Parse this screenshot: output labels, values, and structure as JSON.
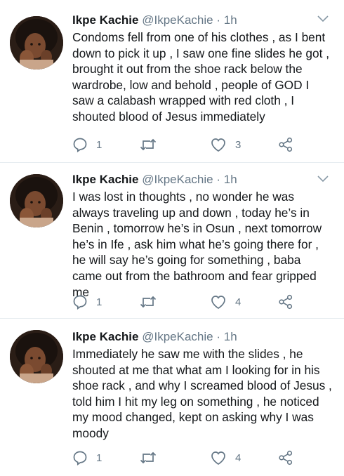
{
  "tweets": [
    {
      "name": "Ikpe Kachie",
      "handle": "@IkpeKachie",
      "separator": "·",
      "time": "1h",
      "text": "Condoms fell from one of his clothes , as I bent down to pick it up , I saw one fine slides he got , brought it out from the shoe rack below the wardrobe, low and behold , people of GOD I saw a calabash wrapped with red cloth , I shouted blood of Jesus immediately",
      "replies": "1",
      "likes": "3"
    },
    {
      "name": "Ikpe Kachie",
      "handle": "@IkpeKachie",
      "separator": "·",
      "time": "1h",
      "text": "I was lost in thoughts , no wonder he was always traveling up and down , today he’s in Benin , tomorrow he’s in Osun , next tomorrow he’s in Ife , ask him what he’s going there for , he will say he’s going for something , baba came out from the bathroom and fear gripped me",
      "replies": "1",
      "likes": "4"
    },
    {
      "name": "Ikpe Kachie",
      "handle": "@IkpeKachie",
      "separator": "·",
      "time": "1h",
      "text": "Immediately he saw me with the slides , he shouted at me that what am I looking for in his shoe rack , and why I screamed blood of Jesus , told him I hit my leg on something , he noticed my mood changed, kept on asking why I was moody",
      "replies": "1",
      "likes": "4"
    }
  ],
  "icons": {
    "reply": "reply-icon",
    "retweet": "retweet-icon",
    "like": "heart-icon",
    "share": "share-icon",
    "menu": "chevron-down-icon"
  },
  "colors": {
    "text": "#14171a",
    "secondary": "#657786",
    "divider": "#e6ecf0"
  }
}
